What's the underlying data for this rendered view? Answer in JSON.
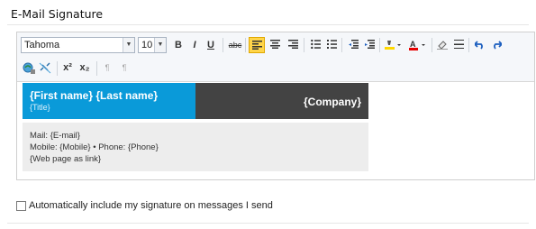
{
  "section": {
    "title": "E-Mail Signature"
  },
  "toolbar": {
    "font_family": "Tahoma",
    "font_size": "10",
    "bold": "B",
    "italic": "I",
    "underline": "U",
    "strikethrough": "abc",
    "superscript": "x²",
    "subscript": "x₂",
    "ltr": "¶",
    "rtl": "¶",
    "colors": {
      "highlight": "#ffd800",
      "text": "#e60000",
      "align_left_active_bg": "#ffd54a"
    }
  },
  "signature": {
    "name": "{First name} {Last name}",
    "title": "{Title}",
    "company": "{Company}",
    "mail": "Mail: {E-mail}",
    "phones": "Mobile: {Mobile} • Phone: {Phone}",
    "web": "{Web page as link}",
    "colors": {
      "left_band": "#0a9ad9",
      "right_band": "#434343",
      "info_bg": "#ededed"
    }
  },
  "options": {
    "auto_include": {
      "label": "Automatically include my signature on messages I send",
      "checked": false
    }
  }
}
